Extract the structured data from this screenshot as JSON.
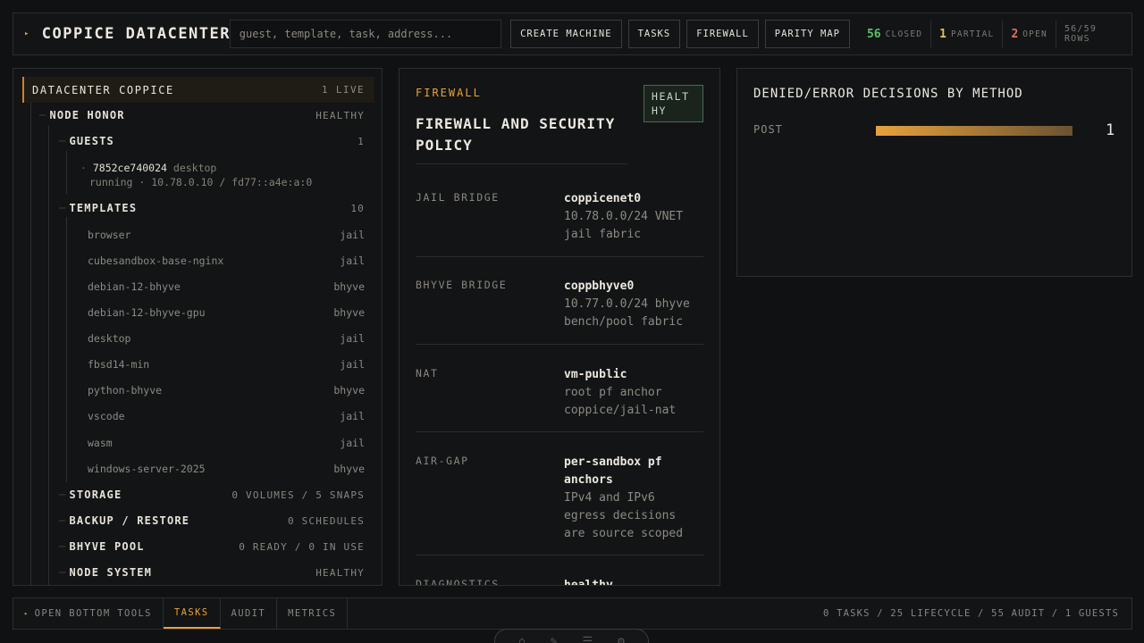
{
  "header": {
    "title": "COPPICE DATACENTER",
    "search_placeholder": "guest, template, task, address...",
    "buttons": [
      "CREATE MACHINE",
      "TASKS",
      "FIREWALL",
      "PARITY MAP"
    ],
    "stats": [
      {
        "num": "56",
        "label": "CLOSED",
        "color": "#5fbf6a"
      },
      {
        "num": "1",
        "label": "PARTIAL",
        "color": "#e2c259"
      },
      {
        "num": "2",
        "label": "OPEN",
        "color": "#e5705a"
      }
    ],
    "rows": "56/59 ROWS"
  },
  "tree": {
    "root": {
      "label": "DATACENTER COPPICE",
      "value": "1 LIVE"
    },
    "node": {
      "label": "NODE HONOR",
      "value": "HEALTHY"
    },
    "guests": {
      "label": "GUESTS",
      "value": "1"
    },
    "guest": {
      "id": "7852ce740024",
      "kind": "desktop",
      "detail": "running · 10.78.0.10 / fd77::a4e:a:0"
    },
    "templates": {
      "label": "TEMPLATES",
      "value": "10"
    },
    "template_items": [
      {
        "name": "browser",
        "type": "jail"
      },
      {
        "name": "cubesandbox-base-nginx",
        "type": "jail"
      },
      {
        "name": "debian-12-bhyve",
        "type": "bhyve"
      },
      {
        "name": "debian-12-bhyve-gpu",
        "type": "bhyve"
      },
      {
        "name": "desktop",
        "type": "jail"
      },
      {
        "name": "fbsd14-min",
        "type": "jail"
      },
      {
        "name": "python-bhyve",
        "type": "bhyve"
      },
      {
        "name": "vscode",
        "type": "jail"
      },
      {
        "name": "wasm",
        "type": "jail"
      },
      {
        "name": "windows-server-2025",
        "type": "bhyve"
      }
    ],
    "storage": {
      "label": "STORAGE",
      "value": "0 VOLUMES / 5 SNAPS"
    },
    "backup": {
      "label": "BACKUP / RESTORE",
      "value": "0 SCHEDULES"
    },
    "pool": {
      "label": "BHYVE POOL",
      "value": "0 READY / 0 IN USE"
    },
    "system": {
      "label": "NODE SYSTEM",
      "value": "HEALTHY"
    }
  },
  "firewall": {
    "kicker": "FIREWALL",
    "title": "FIREWALL AND SECURITY POLICY",
    "badge": "HEALTHY",
    "policies": [
      {
        "key": "JAIL BRIDGE",
        "name": "coppicenet0",
        "desc": "10.78.0.0/24 VNET jail fabric"
      },
      {
        "key": "BHYVE BRIDGE",
        "name": "coppbhyve0",
        "desc": "10.77.0.0/24 bhyve bench/pool fabric"
      },
      {
        "key": "NAT",
        "name": "vm-public",
        "desc": "root pf anchor coppice/jail-nat"
      },
      {
        "key": "AIR-GAP",
        "name": "per-sandbox pf anchors",
        "desc": "IPv4 and IPv6 egress decisions are source scoped"
      },
      {
        "key": "DIAGNOSTICS",
        "name": "healthy",
        "desc": ""
      }
    ]
  },
  "decisions": {
    "title": "DENIED/ERROR DECISIONS BY METHOD",
    "chart_data": {
      "type": "bar",
      "categories": [
        "POST"
      ],
      "values": [
        1
      ],
      "title": "DENIED/ERROR DECISIONS BY METHOD"
    }
  },
  "bottom": {
    "open_label": "OPEN BOTTOM TOOLS",
    "tabs": [
      "TASKS",
      "AUDIT",
      "METRICS"
    ],
    "summary": "0 TASKS / 25 LIFECYCLE / 55 AUDIT / 1 GUESTS"
  },
  "colors": {
    "accent": "#e8a23c",
    "healthy": "#4c6b52"
  }
}
